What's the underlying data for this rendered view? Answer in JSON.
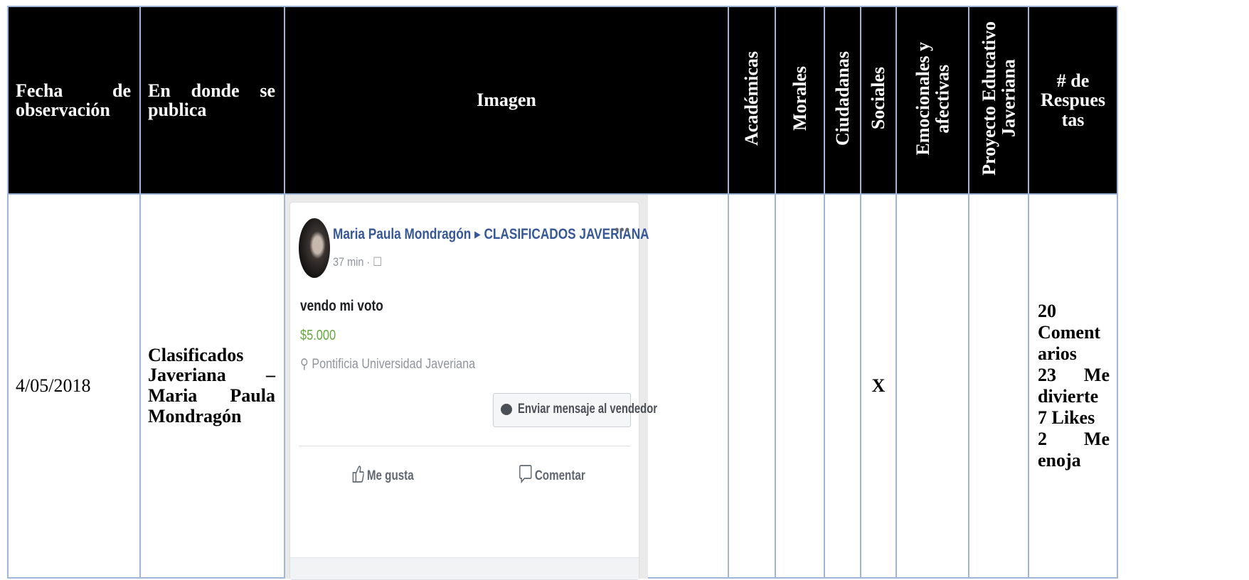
{
  "headers": {
    "fecha_word1": "Fecha",
    "fecha_word2": "de",
    "fecha_word3": "observación",
    "donde_word1": "En",
    "donde_word2": "donde",
    "donde_word3": "se",
    "donde_word4": "publica",
    "imagen": "Imagen",
    "academicas": "Académicas",
    "morales": "Morales",
    "ciudadanas": "Ciudadanas",
    "sociales": "Sociales",
    "emocionales_l1": "Emocionales y",
    "emocionales_l2": "afectivas",
    "proyecto_l1": "Proyecto Educativo",
    "proyecto_l2": "Javeriana",
    "respuestas_l1": "# de",
    "respuestas_l2": "Respues",
    "respuestas_l3": "tas"
  },
  "row": {
    "date": "4/05/2018",
    "source_l1": "Clasificados",
    "source_l2a": "Javeriana",
    "source_l2b": "–",
    "source_l3a": "Maria",
    "source_l3b": "Paula",
    "source_l4": "Mondragón",
    "academicas": "",
    "morales": "",
    "ciudadanas": "",
    "sociales": "X",
    "emocionales": "",
    "proyecto": "",
    "resp_l1": "20",
    "resp_l2": "Coment",
    "resp_l3": "arios",
    "resp_l4a": "23",
    "resp_l4b": "Me",
    "resp_l5": "divierte",
    "resp_l6": "7 Likes",
    "resp_l7a": "2",
    "resp_l7b": "Me",
    "resp_l8": "enoja"
  },
  "post": {
    "author": "Maria Paula Mondragón ▸ CLASIFICADOS JAVERIANA",
    "meta": "37 min · ☐",
    "more": "•••",
    "title": "vendo mi voto",
    "price": "$5.000",
    "location": "⚲ Pontificia Universidad Javeriana",
    "message_button": "Enviar mensaje al vendedor",
    "like_label": "Me gusta",
    "comment_label": "Comentar"
  }
}
